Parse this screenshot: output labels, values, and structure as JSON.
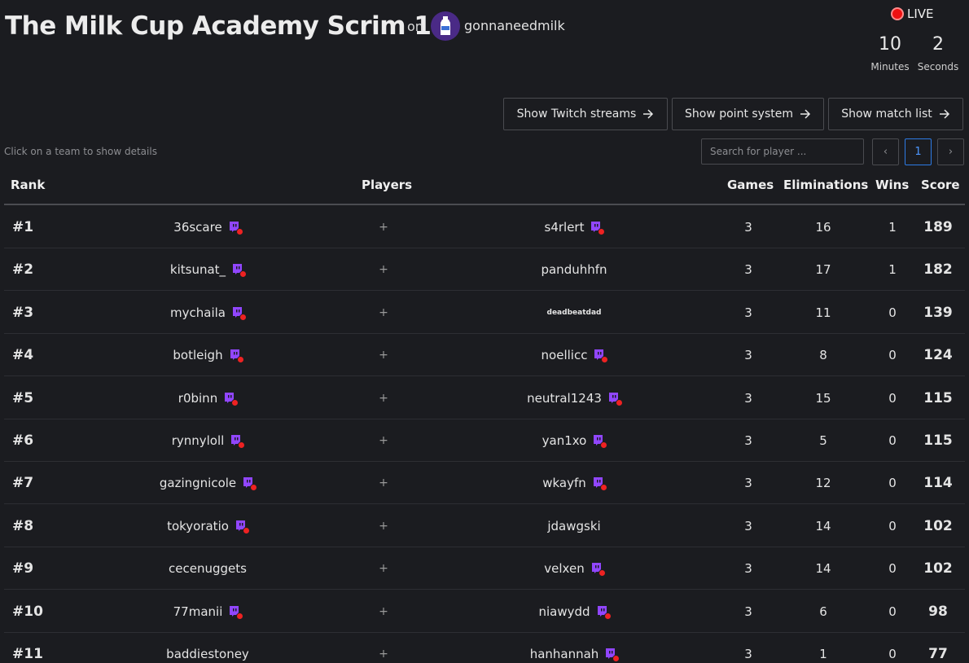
{
  "header": {
    "title": "The Milk Cup Academy Scrim 1",
    "on_label": "on",
    "owner": "gonnaneedmilk"
  },
  "live": {
    "label": "LIVE",
    "minutes_value": "10",
    "minutes_label": "Minutes",
    "seconds_value": "2",
    "seconds_label": "Seconds"
  },
  "buttons": {
    "twitch": "Show Twitch streams",
    "points": "Show point system",
    "matches": "Show match list"
  },
  "hint": "Click on a team to show details",
  "search": {
    "placeholder": "Search for player ..."
  },
  "pagination": {
    "prev": "‹",
    "current": "1",
    "next": "›"
  },
  "columns": {
    "rank": "Rank",
    "players": "Players",
    "games": "Games",
    "eliminations": "Eliminations",
    "wins": "Wins",
    "score": "Score"
  },
  "colors": {
    "twitch": "#9146ff",
    "live_dot": "#ee1111",
    "accent": "#2d7be5"
  },
  "rows": [
    {
      "rank": "#1",
      "p1": "36scare",
      "p1_twitch": true,
      "p2": "s4rlert",
      "p2_twitch": true,
      "games": "3",
      "elims": "16",
      "wins": "1",
      "score": "189"
    },
    {
      "rank": "#2",
      "p1": "kitsunat_",
      "p1_twitch": true,
      "p2": "panduhhfn",
      "p2_twitch": false,
      "games": "3",
      "elims": "17",
      "wins": "1",
      "score": "182"
    },
    {
      "rank": "#3",
      "p1": "mychaila",
      "p1_twitch": true,
      "p2": "deadbeatdad",
      "p2_twitch": false,
      "p2_small": true,
      "games": "3",
      "elims": "11",
      "wins": "0",
      "score": "139"
    },
    {
      "rank": "#4",
      "p1": "botleigh",
      "p1_twitch": true,
      "p2": "noellicc",
      "p2_twitch": true,
      "games": "3",
      "elims": "8",
      "wins": "0",
      "score": "124"
    },
    {
      "rank": "#5",
      "p1": "r0binn",
      "p1_twitch": true,
      "p2": "neutral1243",
      "p2_twitch": true,
      "games": "3",
      "elims": "15",
      "wins": "0",
      "score": "115"
    },
    {
      "rank": "#6",
      "p1": "rynnyloll",
      "p1_twitch": true,
      "p2": "yan1xo",
      "p2_twitch": true,
      "games": "3",
      "elims": "5",
      "wins": "0",
      "score": "115"
    },
    {
      "rank": "#7",
      "p1": "gazingnicole",
      "p1_twitch": true,
      "p2": "wkayfn",
      "p2_twitch": true,
      "games": "3",
      "elims": "12",
      "wins": "0",
      "score": "114"
    },
    {
      "rank": "#8",
      "p1": "tokyoratio",
      "p1_twitch": true,
      "p2": "jdawgski",
      "p2_twitch": false,
      "games": "3",
      "elims": "14",
      "wins": "0",
      "score": "102"
    },
    {
      "rank": "#9",
      "p1": "cecenuggets",
      "p1_twitch": false,
      "p2": "velxen",
      "p2_twitch": true,
      "games": "3",
      "elims": "14",
      "wins": "0",
      "score": "102"
    },
    {
      "rank": "#10",
      "p1": "77manii",
      "p1_twitch": true,
      "p2": "niawydd",
      "p2_twitch": true,
      "games": "3",
      "elims": "6",
      "wins": "0",
      "score": "98"
    },
    {
      "rank": "#11",
      "p1": "baddiestoney",
      "p1_twitch": false,
      "p2": "hanhannah",
      "p2_twitch": true,
      "games": "3",
      "elims": "1",
      "wins": "0",
      "score": "77"
    }
  ]
}
